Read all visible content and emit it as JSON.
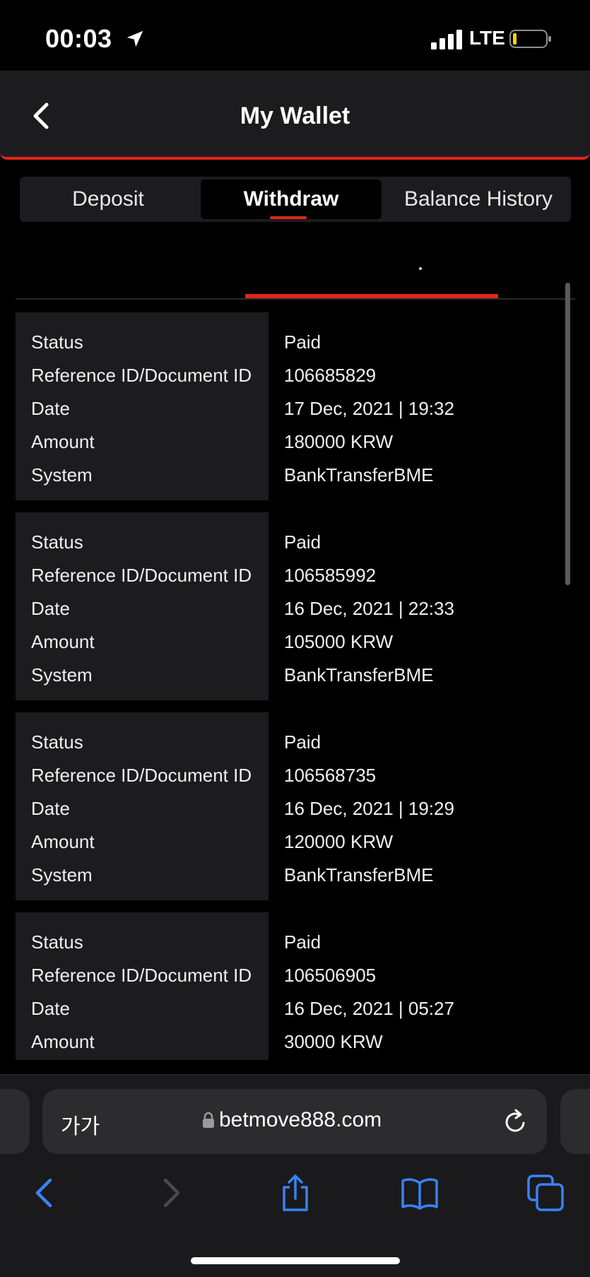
{
  "status_bar": {
    "time": "00:03",
    "network": "LTE"
  },
  "header": {
    "title": "My Wallet"
  },
  "tabs": [
    {
      "label": "Deposit",
      "active": false
    },
    {
      "label": "Withdraw",
      "active": true
    },
    {
      "label": "Balance History",
      "active": false
    }
  ],
  "subtab_marker": ".",
  "record_labels": {
    "status": "Status",
    "reference": "Reference ID/Document ID",
    "date": "Date",
    "amount": "Amount",
    "system": "System"
  },
  "records": [
    {
      "status": "Paid",
      "reference": "106685829",
      "date": "17 Dec, 2021 | 19:32",
      "amount": "180000 KRW",
      "system": "BankTransferBME"
    },
    {
      "status": "Paid",
      "reference": "106585992",
      "date": "16 Dec, 2021 | 22:33",
      "amount": "105000 KRW",
      "system": "BankTransferBME"
    },
    {
      "status": "Paid",
      "reference": "106568735",
      "date": "16 Dec, 2021 | 19:29",
      "amount": "120000 KRW",
      "system": "BankTransferBME"
    },
    {
      "status": "Paid",
      "reference": "106506905",
      "date": "16 Dec, 2021 | 05:27",
      "amount": "30000 KRW",
      "system": ""
    }
  ],
  "browser": {
    "aa_label": "가가",
    "url": "betmove888.com"
  },
  "colors": {
    "accent": "#e1251b",
    "panel": "#1c1c1f",
    "ios_blue": "#3a82f7"
  }
}
